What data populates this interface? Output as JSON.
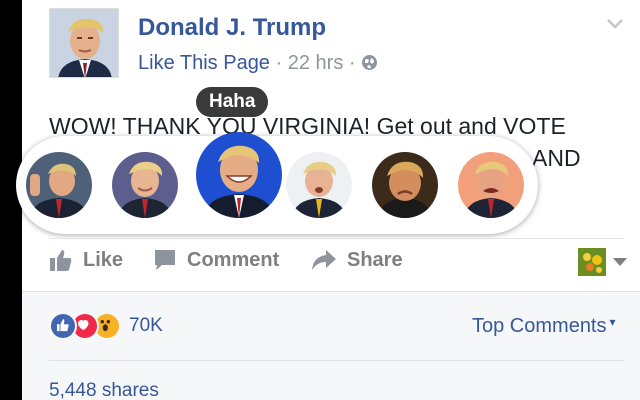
{
  "post": {
    "author": "Donald J. Trump",
    "like_page": "Like This Page",
    "separator": "·",
    "time": "22 hrs",
    "audience_icon": "globe-icon",
    "text_line1": "WOW! THANK YOU VIRGINIA! Get out and VOTE",
    "text_line2": "AND"
  },
  "reactions": {
    "hover_label": "Haha",
    "items": [
      "like",
      "love",
      "haha",
      "wow",
      "sad",
      "angry"
    ]
  },
  "actions": {
    "like": "Like",
    "comment": "Comment",
    "share": "Share"
  },
  "summary": {
    "reaction_icons": [
      "like",
      "love",
      "wow"
    ],
    "count": "70K",
    "sort": "Top Comments",
    "caret": "▾",
    "shares": "5,448 shares"
  },
  "colors": {
    "link": "#365899",
    "muted": "#7f7f7f",
    "like_blue": "#4267b2",
    "love_red": "#f0284a",
    "wow_yellow": "#f7b125"
  }
}
